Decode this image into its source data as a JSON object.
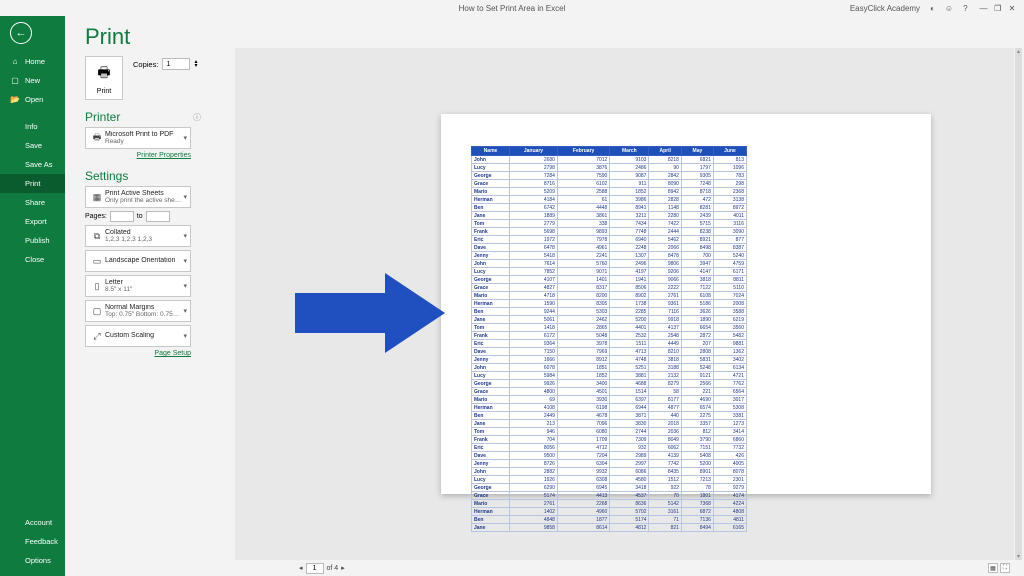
{
  "titlebar": {
    "title": "How to Set Print Area in Excel",
    "account": "EasyClick Academy"
  },
  "sidebar": {
    "back": "←",
    "home": "Home",
    "new": "New",
    "open": "Open",
    "info": "Info",
    "save": "Save",
    "saveas": "Save As",
    "print": "Print",
    "share": "Share",
    "export": "Export",
    "publish": "Publish",
    "close": "Close",
    "account": "Account",
    "feedback": "Feedback",
    "options": "Options"
  },
  "print": {
    "title": "Print",
    "button": "Print",
    "copies_label": "Copies:",
    "copies_value": "1"
  },
  "printer": {
    "heading": "Printer",
    "name": "Microsoft Print to PDF",
    "status": "Ready",
    "properties": "Printer Properties"
  },
  "settings": {
    "heading": "Settings",
    "sheets": {
      "title": "Print Active Sheets",
      "sub": "Only print the active sheets"
    },
    "pages_label": "Pages:",
    "pages_to": "to",
    "collated": {
      "title": "Collated",
      "sub": "1,2,3   1,2,3   1,2,3"
    },
    "orientation": {
      "title": "Landscape Orientation",
      "sub": ""
    },
    "paper": {
      "title": "Letter",
      "sub": "8.5\" x 11\""
    },
    "margins": {
      "title": "Normal Margins",
      "sub": "Top: 0.75\" Bottom: 0.75\" Left..."
    },
    "scaling": {
      "title": "Custom Scaling",
      "sub": ""
    },
    "page_setup": "Page Setup"
  },
  "pager": {
    "page": "1",
    "of": "of 4"
  },
  "chart_data": {
    "type": "table",
    "title": "Monthly values by name (preview)",
    "columns": [
      "Name",
      "January",
      "February",
      "March",
      "April",
      "May",
      "June"
    ],
    "rows": [
      [
        "John",
        2680,
        7012,
        9103,
        8218,
        6821,
        813
      ],
      [
        "Lucy",
        2798,
        3876,
        2486,
        90,
        1797,
        1096
      ],
      [
        "George",
        7284,
        7590,
        9087,
        2842,
        9305,
        783
      ],
      [
        "Grace",
        8716,
        6102,
        911,
        8090,
        7248,
        298
      ],
      [
        "Mario",
        5209,
        2588,
        1852,
        8942,
        8718,
        2368
      ],
      [
        "Herman",
        4184,
        61,
        3986,
        2828,
        472,
        3138
      ],
      [
        "Ben",
        6742,
        4448,
        8941,
        1148,
        8281,
        8972
      ],
      [
        "Jane",
        1889,
        3861,
        3211,
        2280,
        2439,
        4011
      ],
      [
        "Tom",
        2779,
        338,
        7434,
        7422,
        5715,
        3116
      ],
      [
        "Frank",
        5698,
        9893,
        7748,
        2444,
        8238,
        3090
      ],
      [
        "Eric",
        1972,
        7978,
        6940,
        5462,
        8921,
        877
      ],
      [
        "Dave",
        6478,
        4961,
        2248,
        2066,
        8498,
        8387
      ],
      [
        "Jenny",
        5418,
        2241,
        1307,
        8478,
        700,
        5240
      ],
      [
        "John",
        7614,
        5760,
        2496,
        9806,
        3947,
        4759
      ],
      [
        "Lucy",
        7852,
        9071,
        4197,
        9206,
        4147,
        6171
      ],
      [
        "George",
        4107,
        1401,
        1941,
        9066,
        3818,
        8811
      ],
      [
        "Grace",
        4827,
        8317,
        8506,
        2222,
        7122,
        5110
      ],
      [
        "Mario",
        4718,
        8200,
        8902,
        2761,
        6108,
        7024
      ],
      [
        "Herman",
        1590,
        8305,
        1738,
        9361,
        5186,
        2008
      ],
      [
        "Ben",
        9244,
        5303,
        2285,
        7116,
        3626,
        3588
      ],
      [
        "Jane",
        5061,
        2462,
        5200,
        9918,
        1890,
        6219
      ],
      [
        "Tom",
        1418,
        2865,
        4401,
        4137,
        6654,
        3560
      ],
      [
        "Frank",
        6172,
        5048,
        2532,
        2548,
        2872,
        5482
      ],
      [
        "Eric",
        9364,
        3978,
        1511,
        4449,
        207,
        9881
      ],
      [
        "Dave",
        7150,
        7969,
        4713,
        8210,
        2808,
        1362
      ],
      [
        "Jenny",
        1666,
        8912,
        4748,
        3818,
        5831,
        3402
      ],
      [
        "John",
        6078,
        1851,
        5251,
        3188,
        5248,
        6134
      ],
      [
        "Lucy",
        5984,
        1852,
        3881,
        2132,
        9121,
        4721
      ],
      [
        "George",
        9926,
        3400,
        4688,
        8279,
        2566,
        7762
      ],
      [
        "Grace",
        4800,
        4501,
        1514,
        58,
        221,
        6564
      ],
      [
        "Mario",
        69,
        3930,
        6397,
        8177,
        4690,
        3017
      ],
      [
        "Herman",
        4108,
        6198,
        6944,
        4877,
        6574,
        5308
      ],
      [
        "Ben",
        2449,
        4678,
        3871,
        440,
        2275,
        3381
      ],
      [
        "Jane",
        213,
        7096,
        3830,
        2018,
        3357,
        1273
      ],
      [
        "Tom",
        946,
        6080,
        2744,
        2036,
        812,
        3414
      ],
      [
        "Frank",
        704,
        1709,
        7309,
        8049,
        3790,
        6860
      ],
      [
        "Eric",
        8056,
        4712,
        932,
        6062,
        7151,
        7732
      ],
      [
        "Dave",
        9500,
        7204,
        2989,
        4139,
        5408,
        426
      ],
      [
        "Jenny",
        8726,
        6304,
        2997,
        7742,
        5200,
        4005
      ],
      [
        "John",
        2882,
        9932,
        6086,
        8435,
        8901,
        8078
      ],
      [
        "Lucy",
        1926,
        6308,
        4580,
        1512,
        7213,
        2301
      ],
      [
        "George",
        6290,
        6945,
        3418,
        922,
        78,
        9279
      ],
      [
        "Grace",
        5174,
        4413,
        4537,
        70,
        1801,
        4174
      ],
      [
        "Mario",
        2761,
        2268,
        8636,
        5142,
        7368,
        4224
      ],
      [
        "Herman",
        1402,
        4960,
        5702,
        3161,
        6872,
        4808
      ],
      [
        "Ben",
        4848,
        1877,
        5174,
        71,
        7136,
        4811
      ],
      [
        "Jane",
        9858,
        8614,
        4812,
        821,
        8494,
        6165
      ]
    ]
  }
}
